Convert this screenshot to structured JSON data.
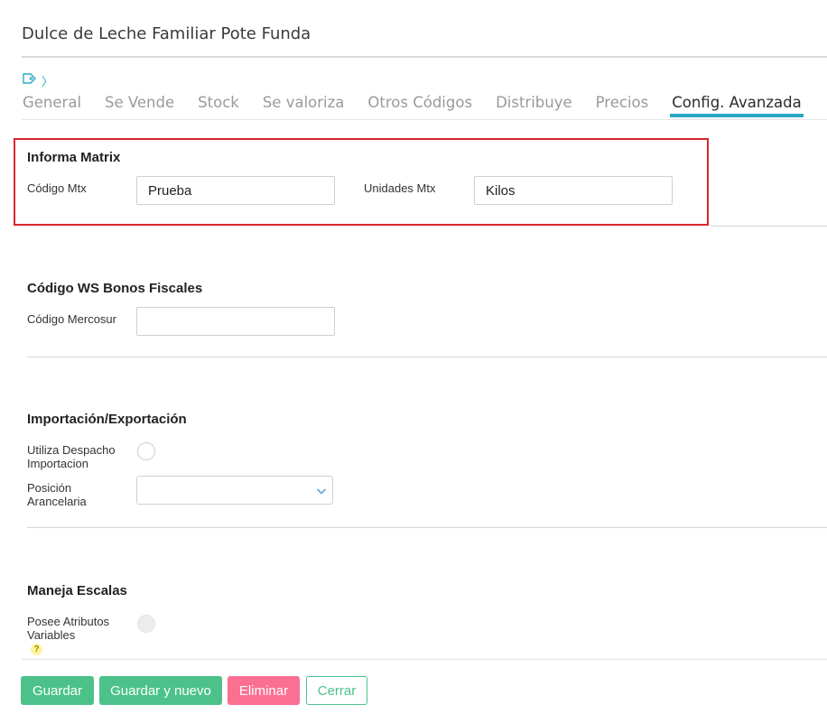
{
  "header": {
    "title": "Dulce de Leche Familiar Pote Funda"
  },
  "breadcrumb": {
    "icon": "tag-icon",
    "separator": "〉"
  },
  "tabs": [
    {
      "label": "General",
      "active": false
    },
    {
      "label": "Se Vende",
      "active": false
    },
    {
      "label": "Stock",
      "active": false
    },
    {
      "label": "Se valoriza",
      "active": false
    },
    {
      "label": "Otros Códigos",
      "active": false
    },
    {
      "label": "Distribuye",
      "active": false
    },
    {
      "label": "Precios",
      "active": false
    },
    {
      "label": "Config. Avanzada",
      "active": true
    }
  ],
  "matrix": {
    "title": "Informa Matrix",
    "codigo_label": "Código Mtx",
    "codigo_value": "Prueba",
    "unidades_label": "Unidades Mtx",
    "unidades_value": "Kilos"
  },
  "bonos": {
    "title": "Código WS Bonos Fiscales",
    "mercosur_label": "Código Mercosur",
    "mercosur_value": ""
  },
  "importacion": {
    "title": "Importación/Exportación",
    "despacho_label_1": "Utiliza Despacho",
    "despacho_label_2": "Importacion",
    "posicion_label_1": "Posición",
    "posicion_label_2": "Arancelaria",
    "posicion_value": ""
  },
  "escalas": {
    "title": "Maneja Escalas",
    "atributos_label_1": "Posee Atributos",
    "atributos_label_2": "Variables",
    "help_symbol": "?"
  },
  "footer": {
    "guardar": "Guardar",
    "guardar_nuevo": "Guardar y nuevo",
    "eliminar": "Eliminar",
    "cerrar": "Cerrar"
  },
  "colors": {
    "accent_tab": "#2aa8c4",
    "highlight_box": "#d9262b",
    "button_green": "#4cc28a",
    "button_pink": "#fb6f92"
  }
}
